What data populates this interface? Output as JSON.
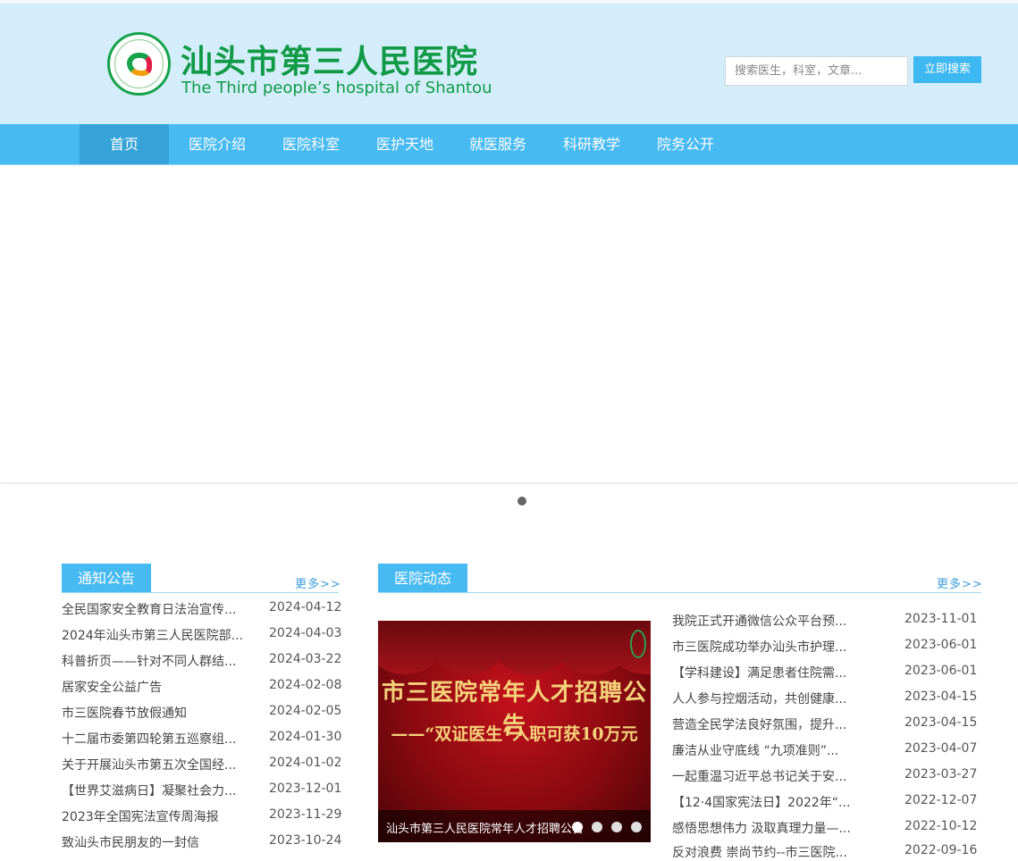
{
  "header": {
    "logo_cn": "汕头市第三人民医院",
    "logo_en": "The Third people’s hospital of Shantou",
    "logo_icon": "hospital-emblem",
    "search_placeholder": "搜索医生，科室，文章...",
    "search_button": "立即搜索"
  },
  "nav": {
    "items": [
      {
        "label": "首页",
        "active": true
      },
      {
        "label": "医院介绍"
      },
      {
        "label": "医院科室"
      },
      {
        "label": "医护天地"
      },
      {
        "label": "就医服务"
      },
      {
        "label": "科研教学"
      },
      {
        "label": "院务公开"
      }
    ]
  },
  "banner": {
    "slide_count": 1,
    "active_slide": 1
  },
  "notices": {
    "title": "通知公告",
    "more": "更多>>",
    "rows": [
      {
        "title": "全民国家安全教育日法治宣传...",
        "date": "2024-04-12"
      },
      {
        "title": "2024年汕头市第三人民医院部...",
        "date": "2024-04-03"
      },
      {
        "title": "科普折页——针对不同人群结...",
        "date": "2024-03-22"
      },
      {
        "title": "居家安全公益广告",
        "date": "2024-02-08"
      },
      {
        "title": "市三医院春节放假通知",
        "date": "2024-02-05"
      },
      {
        "title": "十二届市委第四轮第五巡察组...",
        "date": "2024-01-30"
      },
      {
        "title": "关于开展汕头市第五次全国经...",
        "date": "2024-01-02"
      },
      {
        "title": "【世界艾滋病日】凝聚社会力...",
        "date": "2023-12-01"
      },
      {
        "title": "2023年全国宪法宣传周海报",
        "date": "2023-11-29"
      },
      {
        "title": "致汕头市民朋友的一封信",
        "date": "2023-10-24"
      }
    ]
  },
  "news": {
    "title": "医院动态",
    "more": "更多>>",
    "feature": {
      "headline": "市三医院常年人才招聘公告",
      "subline": "——“双证医生”入职可获10万元",
      "caption": "汕头市第三人民医院常年人才招聘公告",
      "dot_count": 4,
      "active_dot": 1
    },
    "rows": [
      {
        "title": "我院正式开通微信公众平台预...",
        "date": "2023-11-01"
      },
      {
        "title": "市三医院成功举办汕头市护理...",
        "date": "2023-06-01"
      },
      {
        "title": "【学科建设】满足患者住院需...",
        "date": "2023-06-01"
      },
      {
        "title": "人人参与控烟活动，共创健康...",
        "date": "2023-04-15"
      },
      {
        "title": "营造全民学法良好氛围，提升...",
        "date": "2023-04-15"
      },
      {
        "title": "廉洁从业守底线 “九项准则”...",
        "date": "2023-04-07"
      },
      {
        "title": "一起重温习近平总书记关于安...",
        "date": "2023-03-27"
      },
      {
        "title": "【12·4国家宪法日】2022年“...",
        "date": "2022-12-07"
      },
      {
        "title": "感悟思想伟力 汲取真理力量—...",
        "date": "2022-10-12"
      },
      {
        "title": "反对浪费 崇尚节约--市三医院...",
        "date": "2022-09-16"
      }
    ]
  }
}
